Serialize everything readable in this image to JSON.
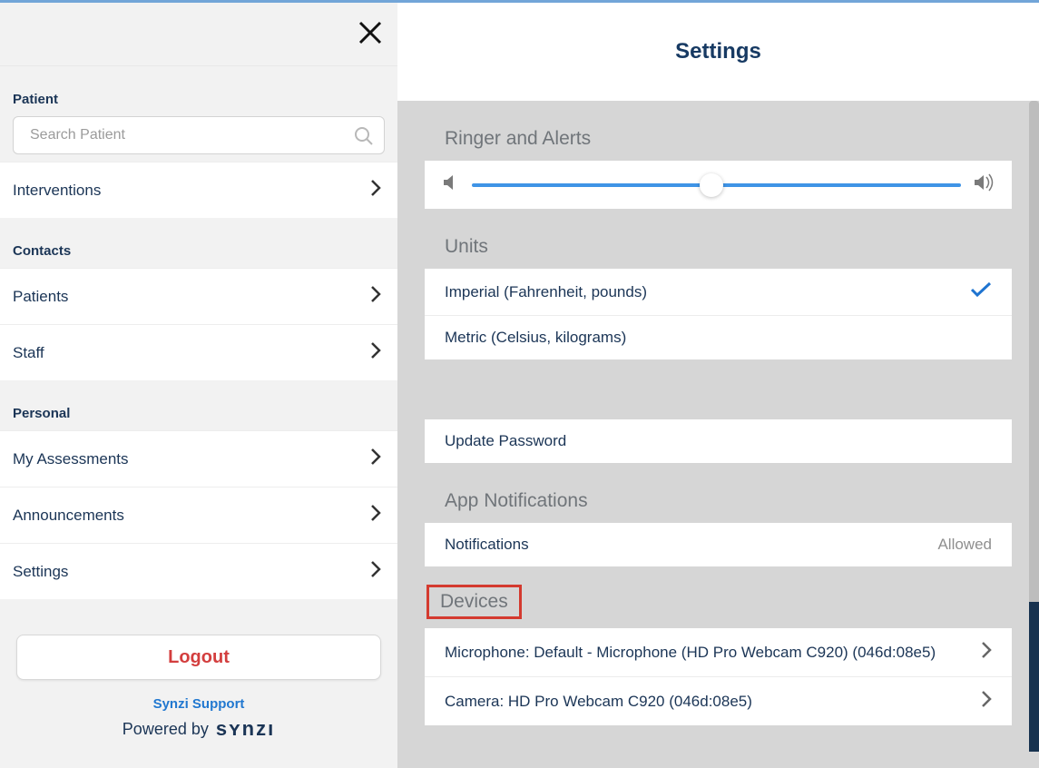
{
  "sidebar": {
    "sections": {
      "patient": {
        "label": "Patient"
      },
      "contacts": {
        "label": "Contacts"
      },
      "personal": {
        "label": "Personal"
      }
    },
    "search": {
      "placeholder": "Search Patient"
    },
    "nav": {
      "interventions": "Interventions",
      "patients": "Patients",
      "staff": "Staff",
      "my_assessments": "My Assessments",
      "announcements": "Announcements",
      "settings": "Settings"
    },
    "logout": "Logout",
    "support": "Synzi Support",
    "powered_by": "Powered by",
    "brand": "sʏnzı"
  },
  "main": {
    "title": "Settings",
    "ringer": {
      "title": "Ringer and Alerts",
      "value_percent": 49
    },
    "units": {
      "title": "Units",
      "options": [
        {
          "label": "Imperial (Fahrenheit, pounds)",
          "selected": true
        },
        {
          "label": "Metric (Celsius, kilograms)",
          "selected": false
        }
      ]
    },
    "update_password": "Update Password",
    "app_notifications": {
      "title": "App Notifications",
      "row_label": "Notifications",
      "status": "Allowed"
    },
    "devices": {
      "title": "Devices",
      "items": [
        "Microphone: Default - Microphone (HD Pro Webcam C920) (046d:08e5)",
        "Camera: HD Pro Webcam C920 (046d:08e5)"
      ]
    }
  }
}
